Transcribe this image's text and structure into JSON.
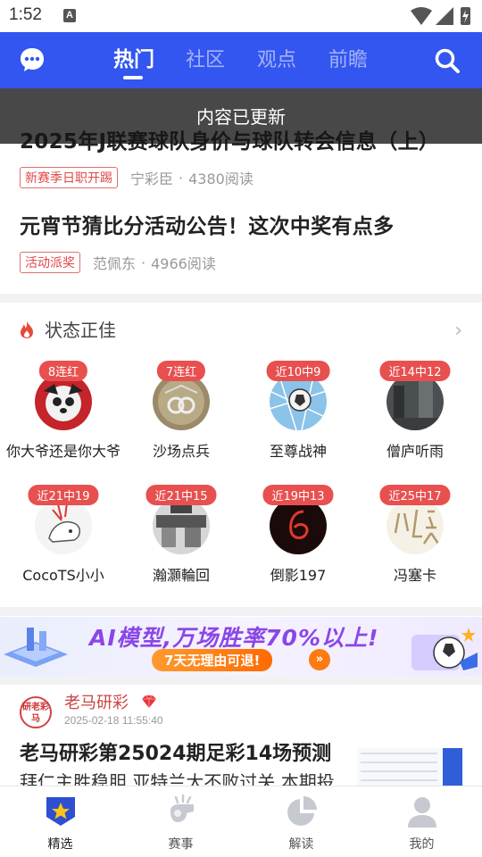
{
  "status_bar": {
    "time": "1:52",
    "app_glyph": "A"
  },
  "header": {
    "tabs": [
      {
        "label": "热门",
        "active": true
      },
      {
        "label": "社区",
        "active": false
      },
      {
        "label": "观点",
        "active": false
      },
      {
        "label": "前瞻",
        "active": false
      }
    ],
    "accent_color": "#3355f0"
  },
  "toast": "内容已更新",
  "articles": [
    {
      "title": "2025年J联赛球队身价与球队转会信息（上）",
      "tag": "新赛季日职开踢",
      "author": "宁彩臣",
      "reads": "4380阅读"
    },
    {
      "title": "元宵节猜比分活动公告！这次中奖有点多",
      "tag": "活动派奖",
      "author": "范佩东",
      "reads": "4966阅读"
    }
  ],
  "meta_separator": "·",
  "hot_section": {
    "title": "状态正佳",
    "experts": [
      {
        "badge": "8连红",
        "name": "你大爷还是你大爷"
      },
      {
        "badge": "7连红",
        "name": "沙场点兵"
      },
      {
        "badge": "近10中9",
        "name": "至尊战神"
      },
      {
        "badge": "近14中12",
        "name": "僧庐听雨"
      },
      {
        "badge": "近21中19",
        "name": "CocoTS小小"
      },
      {
        "badge": "近21中15",
        "name": "瀚灝輪回"
      },
      {
        "badge": "近19中13",
        "name": "倒影197"
      },
      {
        "badge": "近25中17",
        "name": "冯塞卡"
      }
    ]
  },
  "banner": {
    "main": "AI模型,万场胜率70%以上!",
    "sub": "7天无理由可退!",
    "go": "»"
  },
  "card": {
    "avatar_text": "研老彩马",
    "author": "老马研彩",
    "time": "2025-02-18 11:55:40",
    "title": "老马研彩第25024期足彩14场预测",
    "summary": "拜仁主胜稳胆 亚特兰大不败过关 本期投"
  },
  "bottom_nav": [
    {
      "label": "精选",
      "icon": "star-shield-icon",
      "active": true
    },
    {
      "label": "赛事",
      "icon": "whistle-icon",
      "active": false
    },
    {
      "label": "解读",
      "icon": "pie-chart-icon",
      "active": false
    },
    {
      "label": "我的",
      "icon": "user-icon",
      "active": false
    }
  ]
}
